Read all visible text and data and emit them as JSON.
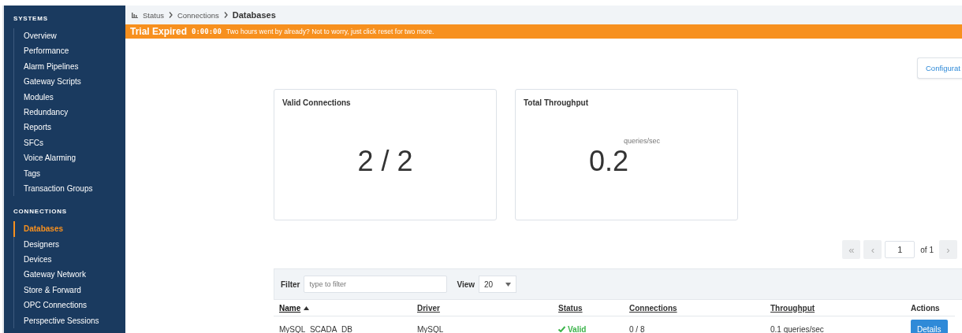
{
  "sidebar": {
    "sections": [
      {
        "title": "SYSTEMS",
        "items": [
          {
            "label": "Overview",
            "selected": false
          },
          {
            "label": "Performance",
            "selected": false
          },
          {
            "label": "Alarm Pipelines",
            "selected": false
          },
          {
            "label": "Gateway Scripts",
            "selected": false
          },
          {
            "label": "Modules",
            "selected": false
          },
          {
            "label": "Redundancy",
            "selected": false
          },
          {
            "label": "Reports",
            "selected": false
          },
          {
            "label": "SFCs",
            "selected": false
          },
          {
            "label": "Voice Alarming",
            "selected": false
          },
          {
            "label": "Tags",
            "selected": false
          },
          {
            "label": "Transaction Groups",
            "selected": false
          }
        ]
      },
      {
        "title": "CONNECTIONS",
        "items": [
          {
            "label": "Databases",
            "selected": true
          },
          {
            "label": "Designers",
            "selected": false
          },
          {
            "label": "Devices",
            "selected": false
          },
          {
            "label": "Gateway Network",
            "selected": false
          },
          {
            "label": "Store & Forward",
            "selected": false
          },
          {
            "label": "OPC Connections",
            "selected": false
          },
          {
            "label": "Perspective Sessions",
            "selected": false
          }
        ]
      }
    ]
  },
  "breadcrumb": [
    "Status",
    "Connections",
    "Databases"
  ],
  "trial_banner": {
    "title": "Trial Expired",
    "timer": "0:00:00",
    "message": "Two hours went by already? Not to worry, just click reset for two more."
  },
  "config_button": "Configurat",
  "cards": [
    {
      "title": "Valid Connections",
      "value": "2 / 2"
    },
    {
      "title": "Total Throughput",
      "value": "0.2",
      "unit": "queries/sec"
    }
  ],
  "pagination": {
    "first": "«",
    "prev": "‹",
    "page": "1",
    "of": "of 1",
    "next": "›"
  },
  "filter": {
    "label": "Filter",
    "placeholder": "type to filter"
  },
  "view": {
    "label": "View",
    "value": "20"
  },
  "table": {
    "columns": [
      {
        "label": "Name",
        "sorted": true,
        "link": true
      },
      {
        "label": "Driver",
        "sorted": false,
        "link": true
      },
      {
        "label": "Status",
        "sorted": false,
        "link": true
      },
      {
        "label": "Connections",
        "sorted": false,
        "link": true
      },
      {
        "label": "Throughput",
        "sorted": false,
        "link": true
      },
      {
        "label": "Actions",
        "sorted": false,
        "link": false
      }
    ],
    "rows": [
      {
        "name": "MySQL_SCADA_DB",
        "driver": "MySQL",
        "status": "Valid",
        "valid": true,
        "connections": "0 / 8",
        "throughput": "0.1 queries/sec",
        "action": "Details"
      }
    ]
  }
}
